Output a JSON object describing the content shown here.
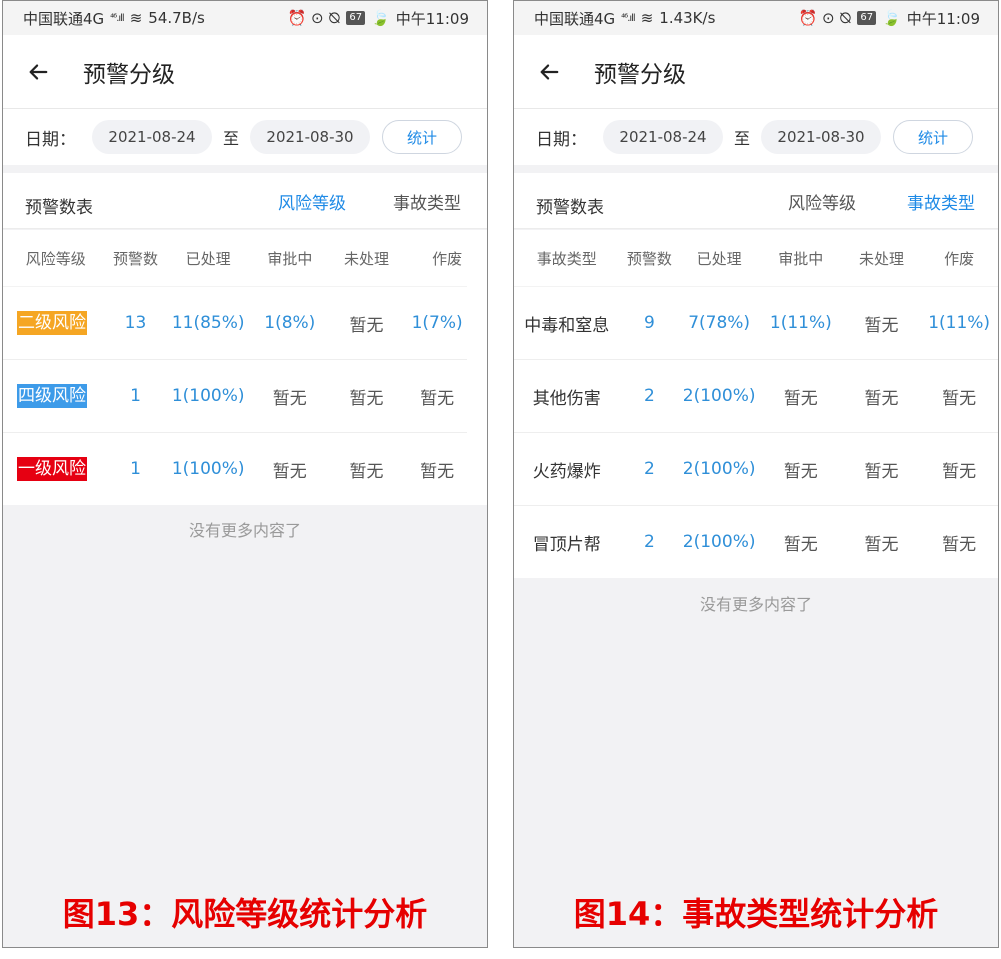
{
  "screens": [
    {
      "status": {
        "carrier": "中国联通4G",
        "signal": "⁴⁶.ıll",
        "speed": "54.7B/s",
        "icons": "⏰ ⊙ ⦰",
        "battery": "67",
        "time": "中午11:09"
      },
      "header": {
        "title": "预警分级"
      },
      "date": {
        "label": "日期：",
        "start": "2021-08-24",
        "sep": "至",
        "end": "2021-08-30",
        "button": "统计"
      },
      "tabs": {
        "title": "预警数表",
        "items": [
          {
            "label": "风险等级",
            "active": true
          },
          {
            "label": "事故类型",
            "active": false
          }
        ]
      },
      "columns": [
        "风险等级",
        "预警数",
        "已处理",
        "审批中",
        "未处理",
        "作废"
      ],
      "rows": [
        {
          "label": "二级风险",
          "color": "#f5a623",
          "values": [
            "13",
            "11(85%)",
            "1(8%)",
            "暂无",
            "1(7%)"
          ]
        },
        {
          "label": "四级风险",
          "color": "#3d9be9",
          "values": [
            "1",
            "1(100%)",
            "暂无",
            "暂无",
            "暂无"
          ]
        },
        {
          "label": "一级风险",
          "color": "#e60012",
          "values": [
            "1",
            "1(100%)",
            "暂无",
            "暂无",
            "暂无"
          ]
        }
      ],
      "no_more": "没有更多内容了",
      "caption": "图13：风险等级统计分析"
    },
    {
      "status": {
        "carrier": "中国联通4G",
        "signal": "⁴⁶.ıll",
        "speed": "1.43K/s",
        "icons": "⏰ ⊙ ⦰",
        "battery": "67",
        "time": "中午11:09"
      },
      "header": {
        "title": "预警分级"
      },
      "date": {
        "label": "日期：",
        "start": "2021-08-24",
        "sep": "至",
        "end": "2021-08-30",
        "button": "统计"
      },
      "tabs": {
        "title": "预警数表",
        "items": [
          {
            "label": "风险等级",
            "active": false
          },
          {
            "label": "事故类型",
            "active": true
          }
        ]
      },
      "columns": [
        "事故类型",
        "预警数",
        "已处理",
        "审批中",
        "未处理",
        "作废"
      ],
      "rows": [
        {
          "label": "中毒和窒息",
          "values": [
            "9",
            "7(78%)",
            "1(11%)",
            "暂无",
            "1(11%)"
          ]
        },
        {
          "label": "其他伤害",
          "values": [
            "2",
            "2(100%)",
            "暂无",
            "暂无",
            "暂无"
          ]
        },
        {
          "label": "火药爆炸",
          "values": [
            "2",
            "2(100%)",
            "暂无",
            "暂无",
            "暂无"
          ]
        },
        {
          "label": "冒顶片帮",
          "values": [
            "2",
            "2(100%)",
            "暂无",
            "暂无",
            "暂无"
          ]
        }
      ],
      "no_more": "没有更多内容了",
      "caption": "图14：事故类型统计分析"
    }
  ]
}
